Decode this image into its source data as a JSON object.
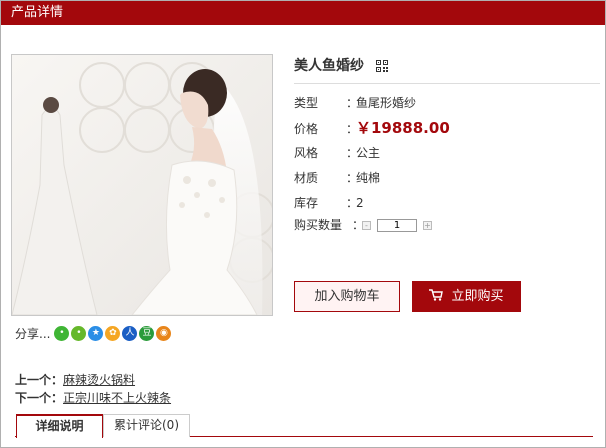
{
  "header": {
    "title": "产品详情"
  },
  "product": {
    "name": "美人鱼婚纱",
    "attributes": [
      {
        "key": "类型",
        "sep": "：",
        "value": "鱼尾形婚纱"
      },
      {
        "key": "价格",
        "sep": "：",
        "value": "￥19888.00"
      },
      {
        "key": "风格",
        "sep": "：",
        "value": "公主"
      },
      {
        "key": "材质",
        "sep": "：",
        "value": "纯棉"
      },
      {
        "key": "库存",
        "sep": "：",
        "value": "2"
      }
    ],
    "quantity": {
      "label": "购买数量",
      "sep": "：",
      "value": "1",
      "minus": "-",
      "plus": "+"
    }
  },
  "actions": {
    "add_to_cart": "加入购物车",
    "buy_now": "立即购买"
  },
  "share": {
    "label": "分享...",
    "icons": [
      {
        "name": "wechat-icon",
        "color": "#3fb535",
        "glyph": ""
      },
      {
        "name": "qq-space-icon",
        "color": "#66b82b",
        "glyph": ""
      },
      {
        "name": "qzone-star-icon",
        "color": "#2a8ee6",
        "glyph": ""
      },
      {
        "name": "pengyou-icon",
        "color": "#f5a623",
        "glyph": ""
      },
      {
        "name": "renren-icon",
        "color": "#1a5ec4",
        "glyph": "人"
      },
      {
        "name": "douban-icon",
        "color": "#2b9b3a",
        "glyph": "豆"
      },
      {
        "name": "weibo-icon",
        "color": "#e8851a",
        "glyph": ""
      }
    ]
  },
  "navigation": {
    "prev_label": "上一个：",
    "prev_link": "麻辣烫火锅料",
    "next_label": "下一个：",
    "next_link": "正宗川味不上火辣条"
  },
  "tabs": [
    {
      "label": "详细说明"
    },
    {
      "label": "累计评论(0)"
    }
  ],
  "colors": {
    "brand": "#a3080c",
    "border": "#b0b0b0"
  }
}
